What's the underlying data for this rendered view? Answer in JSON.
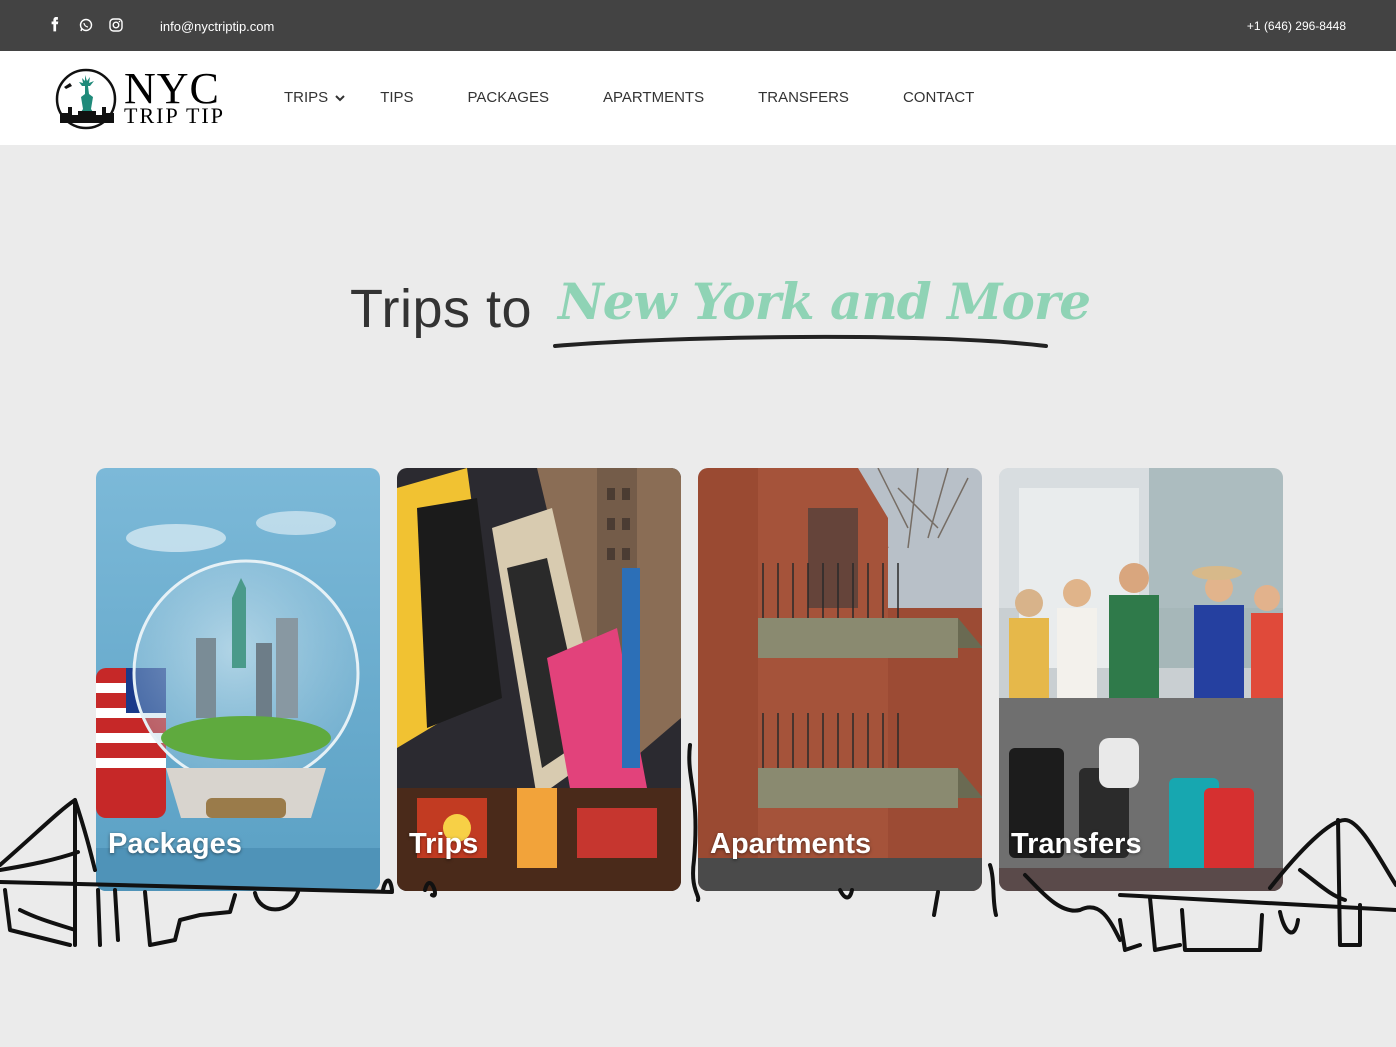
{
  "topbar": {
    "email": "info@nyctriptip.com",
    "phone": "+1 (646) 296-8448",
    "social": [
      "facebook-icon",
      "whatsapp-icon",
      "instagram-icon"
    ]
  },
  "logo": {
    "line1": "NYC",
    "line2": "TRIP TIP"
  },
  "nav": {
    "items": [
      {
        "label": "TRIPS",
        "dropdown": true
      },
      {
        "label": "TIPS"
      },
      {
        "label": "PACKAGES"
      },
      {
        "label": "APARTMENTS"
      },
      {
        "label": "TRANSFERS"
      },
      {
        "label": "CONTACT"
      }
    ]
  },
  "hero": {
    "title_plain": "Trips to",
    "title_script": "New York and More",
    "accent_color": "#8fd3b5"
  },
  "cards": [
    {
      "label": "Packages",
      "image": "snow-globe-statue-of-liberty"
    },
    {
      "label": "Trips",
      "image": "times-square-billboards"
    },
    {
      "label": "Apartments",
      "image": "brick-apartment-balconies"
    },
    {
      "label": "Transfers",
      "image": "travelers-with-luggage"
    }
  ]
}
